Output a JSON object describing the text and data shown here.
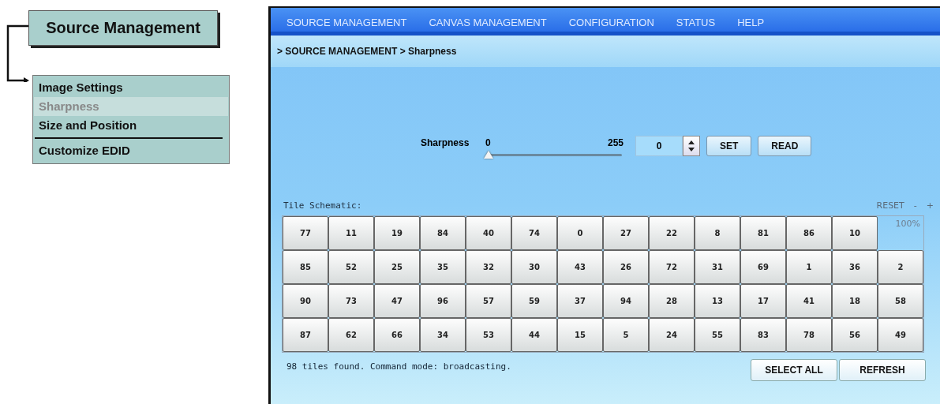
{
  "diagram": {
    "title": "Source Management",
    "menu": [
      {
        "label": "Image Settings",
        "selected": false,
        "divider_after": false
      },
      {
        "label": "Sharpness",
        "selected": true,
        "divider_after": false
      },
      {
        "label": "Size and Position",
        "selected": false,
        "divider_after": true
      },
      {
        "label": "Customize EDID",
        "selected": false,
        "divider_after": false
      }
    ]
  },
  "nav": [
    "SOURCE MANAGEMENT",
    "CANVAS MANAGEMENT",
    "CONFIGURATION",
    "STATUS",
    "HELP"
  ],
  "breadcrumb": "> SOURCE MANAGEMENT > Sharpness",
  "sharpness": {
    "label": "Sharpness",
    "min": "0",
    "max": "255",
    "level": 0,
    "value": "0",
    "buttons": [
      "SET",
      "READ"
    ]
  },
  "tiles": {
    "label": "Tile Schematic:",
    "controls": [
      "RESET",
      "-",
      "+"
    ],
    "zoom": "100%",
    "rows": [
      [
        "77",
        "11",
        "19",
        "84",
        "40",
        "74",
        "0",
        "27",
        "22",
        "8",
        "81",
        "86",
        "10"
      ],
      [
        "85",
        "52",
        "25",
        "35",
        "32",
        "30",
        "43",
        "26",
        "72",
        "31",
        "69",
        "1",
        "36",
        "2"
      ],
      [
        "90",
        "73",
        "47",
        "96",
        "57",
        "59",
        "37",
        "94",
        "28",
        "13",
        "17",
        "41",
        "18",
        "58"
      ],
      [
        "87",
        "62",
        "66",
        "34",
        "53",
        "44",
        "15",
        "5",
        "24",
        "55",
        "83",
        "78",
        "56",
        "49"
      ]
    ]
  },
  "status": "98 tiles found. Command mode: broadcasting.",
  "buttons": [
    "SELECT ALL",
    "REFRESH"
  ]
}
